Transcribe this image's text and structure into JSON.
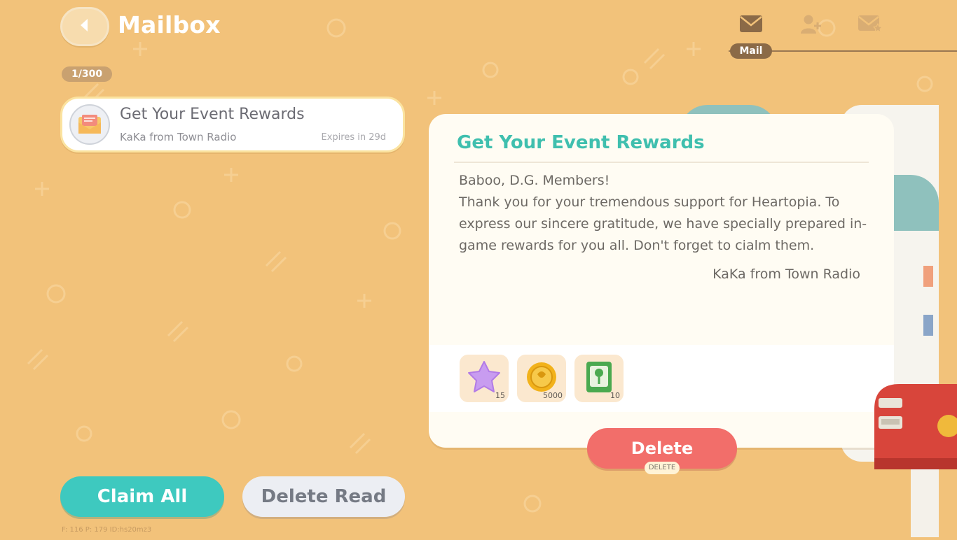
{
  "header": {
    "title": "Mailbox",
    "count": "1/300"
  },
  "tabs": {
    "active_label": "Mail",
    "icons": [
      "mail-icon",
      "add-friend-icon",
      "starred-mail-icon"
    ]
  },
  "mail_list": [
    {
      "title": "Get Your Event Rewards",
      "sender": "KaKa from Town Radio",
      "expiry": "Expires in 29d",
      "icon": "envelope-icon"
    }
  ],
  "detail": {
    "title": "Get Your Event Rewards",
    "greeting": "Baboo, D.G. Members!",
    "body": "Thank you for your tremendous support for Heartopia. To express our sincere gratitude, we have specially prepared in-game rewards for you all. Don't forget to cialm them.",
    "signoff": "KaKa from Town Radio",
    "rewards": [
      {
        "item": "purple-star-icon",
        "count": "15"
      },
      {
        "item": "gold-coin-icon",
        "count": "5000"
      },
      {
        "item": "green-seed-pack-icon",
        "count": "10"
      }
    ],
    "delete_label": "Delete",
    "delete_hint": "DELETE"
  },
  "actions": {
    "claim_all": "Claim All",
    "delete_read": "Delete Read"
  },
  "debug_text": "F: 116    P: 179    ID:hs20mz3",
  "colors": {
    "background": "#f2c27a",
    "accent_teal": "#3ec9bf",
    "delete_red": "#f26e6a"
  }
}
